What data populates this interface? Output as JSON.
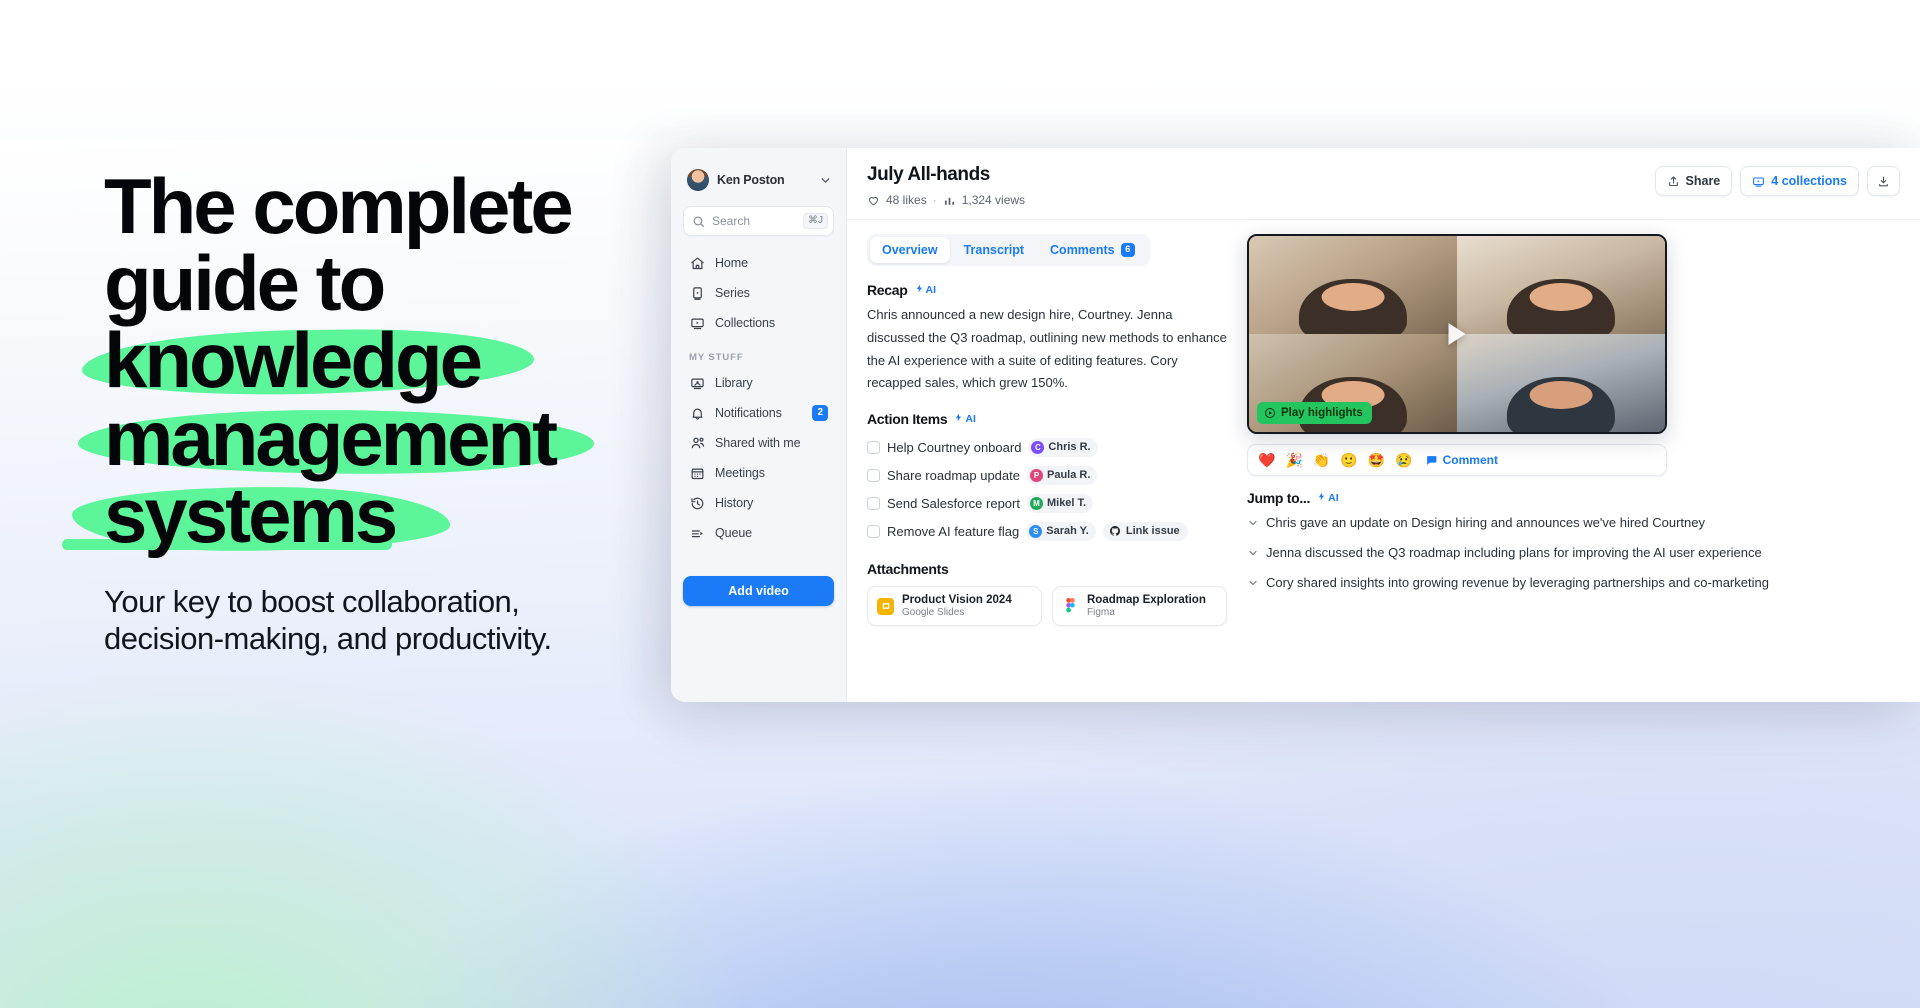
{
  "hero": {
    "line1": "The complete",
    "line2": "guide to",
    "line3_hl": "knowledge",
    "line4_hl": "management",
    "line5_hl": "systems",
    "sub_line1": "Your key to boost collaboration,",
    "sub_line2": "decision-making, and productivity.",
    "highlight_color": "#5cf59a"
  },
  "sidebar": {
    "account": {
      "name": "Ken Poston",
      "chevron_icon": "chevron-down-icon",
      "avatar_icon": "avatar"
    },
    "search": {
      "placeholder": "Search",
      "shortcut": "⌘J",
      "icon": "search-icon"
    },
    "nav": [
      {
        "label": "Home",
        "icon": "home-icon"
      },
      {
        "label": "Series",
        "icon": "series-icon"
      },
      {
        "label": "Collections",
        "icon": "collections-icon"
      }
    ],
    "section_label": "MY STUFF",
    "my_stuff": [
      {
        "label": "Library",
        "icon": "library-icon"
      },
      {
        "label": "Notifications",
        "icon": "bell-icon",
        "badge": "2"
      },
      {
        "label": "Shared with me",
        "icon": "people-icon"
      },
      {
        "label": "Meetings",
        "icon": "calendar-icon"
      },
      {
        "label": "History",
        "icon": "history-icon"
      },
      {
        "label": "Queue",
        "icon": "queue-icon"
      }
    ],
    "add_video_label": "Add video",
    "accent_color": "#1a7af8"
  },
  "main": {
    "title": "July All-hands",
    "likes": "48 likes",
    "views": "1,324 views",
    "meta_sep": "·",
    "actions": [
      {
        "label": "Share",
        "icon": "share-icon"
      },
      {
        "label": "4 collections",
        "icon": "collections-icon"
      }
    ],
    "tabs": [
      {
        "label": "Overview",
        "active": true
      },
      {
        "label": "Transcript",
        "active": false
      },
      {
        "label": "Comments",
        "active": false,
        "badge": "6"
      }
    ],
    "recap": {
      "title": "Recap",
      "ai_label": "AI",
      "text": "Chris announced a new design hire, Courtney. Jenna discussed the Q3 roadmap, outlining new methods to enhance the AI experience with a suite of editing features. Cory recapped sales, which grew 150%."
    },
    "action_items": {
      "title": "Action Items",
      "ai_label": "AI",
      "items": [
        {
          "text": "Help Courtney onboard",
          "assignee": "Chris R.",
          "initial": "C",
          "color": "#7c4dff"
        },
        {
          "text": "Share roadmap update",
          "assignee": "Paula R.",
          "initial": "P",
          "color": "#e0457b"
        },
        {
          "text": "Send Salesforce report",
          "assignee": "Mikel T.",
          "initial": "M",
          "color": "#1faa59"
        },
        {
          "text": "Remove AI feature flag",
          "assignee": "Sarah Y.",
          "initial": "S",
          "color": "#2c8ef4",
          "link_label": "Link issue",
          "link_icon": "github-icon"
        }
      ]
    },
    "attachments": {
      "title": "Attachments",
      "items": [
        {
          "name": "Product Vision 2024",
          "source": "Google Slides",
          "icon": "slides-icon",
          "color": "#f5b400"
        },
        {
          "name": "Roadmap Exploration",
          "source": "Figma",
          "icon": "figma-icon",
          "color": "#f24e1e"
        }
      ]
    },
    "video": {
      "play_highlights_label": "Play highlights",
      "play_icon": "play-icon",
      "highlight_button_color": "#22c55e"
    },
    "reactions": {
      "emojis": [
        "❤️",
        "🎉",
        "👏",
        "🙂",
        "🤩",
        "😢"
      ],
      "comment_label": "Comment",
      "comment_icon": "comment-icon"
    },
    "jump_to": {
      "title": "Jump to...",
      "ai_label": "AI",
      "items": [
        "Chris gave an update on Design hiring and announces we've hired Courtney",
        "Jenna discussed the Q3 roadmap including plans for improving the AI user experience",
        "Cory shared insights into growing revenue by leveraging partnerships and co-marketing"
      ]
    }
  }
}
